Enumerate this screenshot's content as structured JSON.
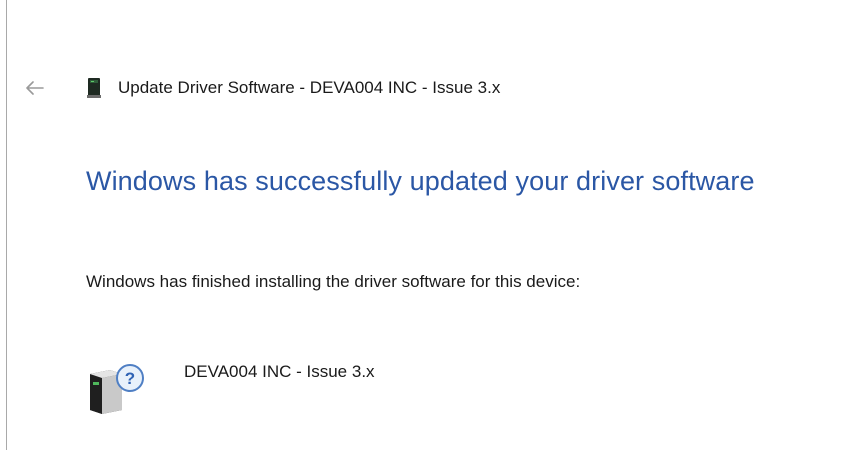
{
  "window": {
    "title": "Update Driver Software - DEVA004 INC - Issue 3.x",
    "back_icon": "back-arrow-icon",
    "title_icon": "driver-device-icon"
  },
  "main": {
    "heading": "Windows has successfully updated your driver software",
    "description": "Windows has finished installing the driver software for this device:",
    "device": {
      "name": "DEVA004 INC - Issue 3.x",
      "icon": "unknown-device-icon"
    }
  },
  "colors": {
    "heading": "#2b57a5",
    "text": "#1a1a1a",
    "back_arrow": "#9a9a9a",
    "border": "#a9a9a9"
  }
}
